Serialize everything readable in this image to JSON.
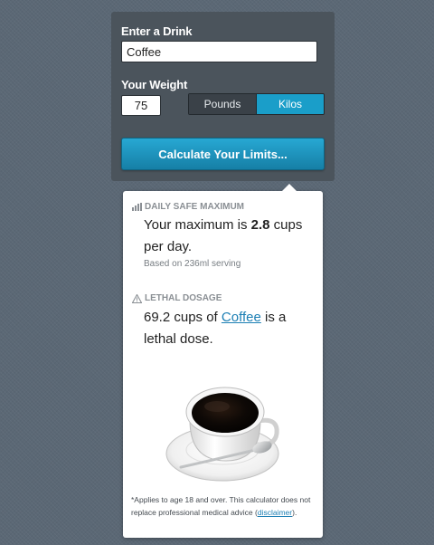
{
  "form": {
    "drink_label": "Enter a Drink",
    "drink_value": "Coffee",
    "weight_label": "Your Weight",
    "weight_value": "75",
    "units": [
      "Pounds",
      "Kilos"
    ],
    "selected_unit": "Kilos",
    "calculate_label": "Calculate Your Limits..."
  },
  "result": {
    "max_heading": "DAILY SAFE MAXIMUM",
    "max_prefix": "Your maximum is ",
    "max_value": "2.8",
    "max_suffix": " cups per day.",
    "serving_note": "Based on 236ml serving",
    "lethal_heading": "LETHAL DOSAGE",
    "lethal_prefix": "69.2 cups of ",
    "lethal_drink": "Coffee",
    "lethal_suffix": " is a lethal dose.",
    "disclaimer_text": "*Applies to age 18 and over. This calculator does not replace professional medical advice (",
    "disclaimer_link": "disclaimer",
    "disclaimer_end": ")."
  },
  "colors": {
    "background": "#5b6875",
    "panel": "#4b545c",
    "accent": "#1a9ec9",
    "link": "#1c7fb4"
  },
  "icons": [
    "chart-icon",
    "warning-icon"
  ]
}
